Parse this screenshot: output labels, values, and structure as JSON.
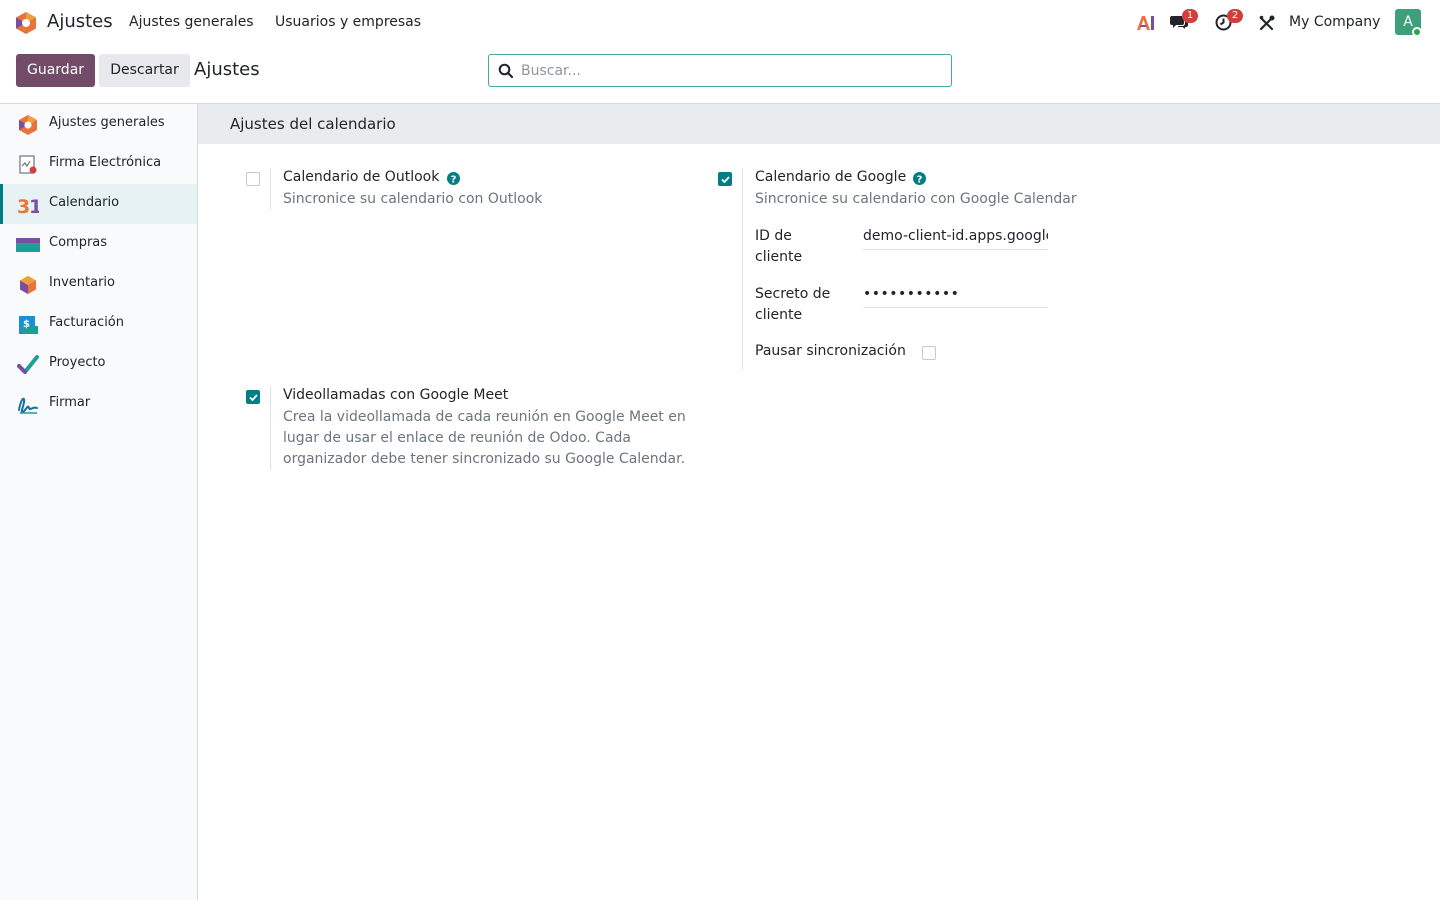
{
  "navbar": {
    "app_name": "Ajustes",
    "menu": [
      "Ajustes generales",
      "Usuarios y empresas"
    ],
    "messages_badge": "1",
    "activities_badge": "2",
    "company": "My Company",
    "avatar_initial": "A"
  },
  "control_panel": {
    "save_label": "Guardar",
    "discard_label": "Descartar",
    "title": "Ajustes",
    "search_placeholder": "Buscar..."
  },
  "sidebar": {
    "items": [
      {
        "label": "Ajustes generales",
        "icon": "settings-app-icon"
      },
      {
        "label": "Firma Electrónica",
        "icon": "electronic-signature-icon"
      },
      {
        "label": "Calendario",
        "icon": "calendar-app-icon",
        "active": true
      },
      {
        "label": "Compras",
        "icon": "purchase-app-icon"
      },
      {
        "label": "Inventario",
        "icon": "inventory-app-icon"
      },
      {
        "label": "Facturación",
        "icon": "invoicing-app-icon"
      },
      {
        "label": "Proyecto",
        "icon": "project-app-icon"
      },
      {
        "label": "Firmar",
        "icon": "sign-app-icon"
      }
    ]
  },
  "main": {
    "section_title": "Ajustes del calendario",
    "outlook": {
      "title": "Calendario de Outlook",
      "desc": "Sincronice su calendario con Outlook",
      "checked": false
    },
    "google": {
      "title": "Calendario de Google",
      "desc": "Sincronice su calendario con Google Calendar",
      "checked": true,
      "client_id_label_1": "ID de",
      "client_id_label_2": "cliente",
      "client_id_value": "demo-client-id.apps.google",
      "client_secret_label_1": "Secreto de",
      "client_secret_label_2": "cliente",
      "client_secret_value": "•••••••••••",
      "pause_label": "Pausar sincronización",
      "pause_checked": false
    },
    "meet": {
      "title": "Videollamadas con Google Meet",
      "desc_1": "Crea la videollamada de cada reunión en Google Meet en",
      "desc_2": "lugar de usar el enlace de reunión de Odoo. Cada",
      "desc_3": "organizador debe tener sincronizado su Google Calendar.",
      "checked": true
    }
  },
  "colors": {
    "brand": "#714b67",
    "accent": "#017e84",
    "badge": "#d23f3a"
  }
}
